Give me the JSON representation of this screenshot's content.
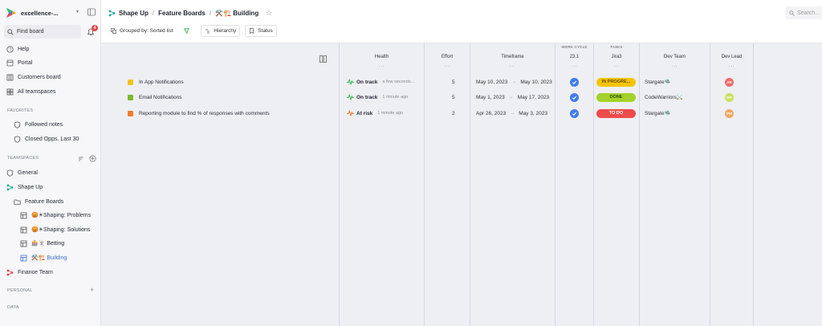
{
  "workspace": {
    "name": "excellence-..."
  },
  "search": {
    "find_board": "Find board",
    "notif_count": "4",
    "top_placeholder": "Search..."
  },
  "nav": {
    "help": "Help",
    "portal": "Portal",
    "customers_board": "Customers board",
    "all_teamspaces": "All teamspaces"
  },
  "favorites": {
    "label": "FAVORITES",
    "items": [
      "Followed notes",
      "Closed Opps. Last 30"
    ]
  },
  "teamspaces": {
    "label": "TEAMSPACES",
    "general": "General",
    "shape_up": "Shape Up",
    "feature_boards": "Feature Boards",
    "boards": [
      "😡☀Shaping: Problems",
      "😡☀Shaping: Solutions",
      "🎰🃏 Betting",
      "⚒️🏗️ Building"
    ],
    "finance_team": "Finance Team"
  },
  "personal": {
    "label": "PERSONAL"
  },
  "data_section": {
    "label": "DATA"
  },
  "breadcrumb": {
    "root": "Shape Up",
    "sep": "/",
    "parent": "Feature Boards",
    "current": "⚒️🏗️ Building"
  },
  "toolbar": {
    "grouped": "Grouped by: Sorted list",
    "hierarchy": "Hierarchy",
    "status": "Status"
  },
  "columns": {
    "health": "Health",
    "effort": "Effort",
    "timeframe": "Timeframe",
    "work_cycle_group": "WORK CYCLE",
    "work_cycle": "23.1",
    "tasks_group": "TASKS",
    "jira": "Jira3",
    "dev_team": "Dev Team",
    "dev_lead": "Dev Lead",
    "dots": "···"
  },
  "rows": [
    {
      "name": "In App Notifications",
      "color": "#f2c21b",
      "health": "On track",
      "health_time": "a few seconds...",
      "health_color": "#37b24d",
      "effort": "5",
      "start": "May 10, 2023",
      "end": "May 10, 2023",
      "arrow": "→",
      "status": "IN PROGRE...",
      "status_bg": "#f5c400",
      "status_fg": "#6b4b00",
      "team": "Stargate🛸",
      "lead": "AR",
      "lead_color": "#ef6b6b"
    },
    {
      "name": "Email Notifications",
      "color": "#7ab82b",
      "health": "On track",
      "health_time": "1 minute ago",
      "health_color": "#37b24d",
      "effort": "5",
      "start": "May 1, 2023",
      "end": "May 17, 2023",
      "arrow": "→",
      "status": "DONE",
      "status_bg": "#a4d22a",
      "status_fg": "#2f4a00",
      "team": "CodeWarriors⚔️",
      "lead": "NP",
      "lead_color": "#c7e25c"
    },
    {
      "name": "Reporting module to find % of responses with comments",
      "color": "#f07a2e",
      "health": "At risk",
      "health_time": "1 minute ago",
      "health_color": "#f07a2e",
      "effort": "2",
      "start": "Apr 26, 2023",
      "end": "May 3, 2023",
      "arrow": "→",
      "status": "TO DO",
      "status_bg": "#ee4b4b",
      "status_fg": "#ffffff",
      "team": "Stargate🛸",
      "lead": "PM",
      "lead_color": "#f0a860"
    }
  ]
}
